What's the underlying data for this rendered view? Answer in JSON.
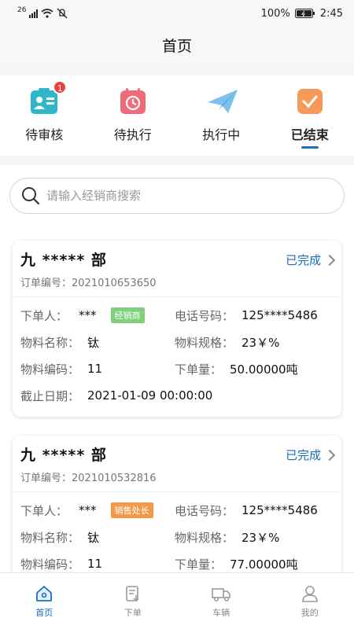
{
  "status_bar": {
    "network": "26",
    "battery": "100%",
    "time": "2:45"
  },
  "header": {
    "title": "首页"
  },
  "categories": [
    {
      "label": "待审核",
      "badge": "1",
      "icon": "audit-icon",
      "color": "#2fb7c9"
    },
    {
      "label": "待执行",
      "icon": "calendar-clock-icon",
      "color": "#ee6b7a"
    },
    {
      "label": "执行中",
      "icon": "paper-plane-icon",
      "color": "#5aa6e6"
    },
    {
      "label": "已结束",
      "icon": "checkbox-icon",
      "color": "#f59a5a",
      "active": true
    }
  ],
  "search": {
    "placeholder": "请输入经销商搜索"
  },
  "orders": [
    {
      "shop": "九 ***** 部",
      "order_no": "订单编号：2021010653650",
      "status": "已完成",
      "orderer_label": "下单人：",
      "orderer": "***",
      "role_tag": "经销商",
      "role_color": "#7ed07a",
      "phone_label": "电话号码：",
      "phone": "125****5486",
      "material_label": "物料名称：",
      "material": "钛",
      "spec_label": "物料规格：",
      "spec": "23￥%",
      "code_label": "物料编码：",
      "code": "11",
      "qty_label": "下单量：",
      "qty": "50.00000吨",
      "deadline_label": "截止日期：",
      "deadline": "2021-01-09 00:00:00"
    },
    {
      "shop": "九 ***** 部",
      "order_no": "订单编号：2021010532816",
      "status": "已完成",
      "orderer_label": "下单人：",
      "orderer": "***",
      "role_tag": "销售处长",
      "role_color": "#f29a4a",
      "phone_label": "电话号码：",
      "phone": "125****5486",
      "material_label": "物料名称：",
      "material": "钛",
      "spec_label": "物料规格：",
      "spec": "23￥%",
      "code_label": "物料编码：",
      "code": "11",
      "qty_label": "下单量：",
      "qty": "77.00000吨"
    }
  ],
  "tabbar": [
    {
      "label": "首页",
      "icon": "home-icon",
      "active": true
    },
    {
      "label": "下单",
      "icon": "order-icon"
    },
    {
      "label": "车辆",
      "icon": "truck-icon"
    },
    {
      "label": "我的",
      "icon": "profile-icon"
    }
  ],
  "colors": {
    "accent": "#1a6ec2"
  }
}
